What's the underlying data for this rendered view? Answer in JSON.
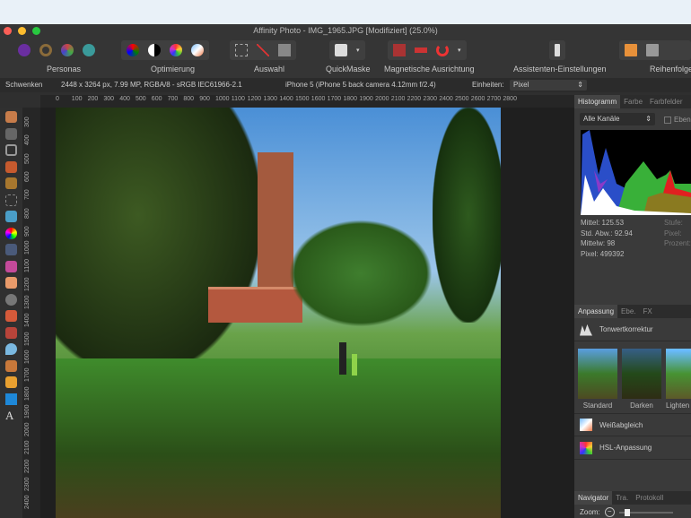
{
  "window": {
    "title": "Affinity Photo - IMG_1965.JPG [Modifiziert] (25.0%)"
  },
  "toolbar": {
    "groups": [
      "Personas",
      "Optimierung",
      "Auswahl",
      "QuickMaske",
      "Magnetische Ausrichtung",
      "Assistenten-Einstellungen",
      "Reihenfolge"
    ]
  },
  "context": {
    "tool": "Schwenken",
    "image_info": "2448 x 3264 px, 7.99 MP, RGBA/8 - sRGB IEC61966-2.1",
    "camera": "iPhone 5 (iPhone 5 back camera 4.12mm f/2.4)",
    "units_label": "Einheiten:",
    "units_value": "Pixel"
  },
  "ruler": {
    "unit": "px",
    "h_ticks": [
      "0",
      "100",
      "200",
      "300",
      "400",
      "500",
      "600",
      "700",
      "800",
      "900",
      "1000",
      "1100",
      "1200",
      "1300",
      "1400",
      "1500",
      "1600",
      "1700",
      "1800",
      "1900",
      "2000",
      "2100",
      "2200",
      "2300",
      "2400",
      "2500",
      "2600",
      "2700",
      "2800"
    ],
    "v_ticks": [
      "300",
      "400",
      "500",
      "600",
      "700",
      "800",
      "900",
      "1000",
      "1100",
      "1200",
      "1300",
      "1400",
      "1500",
      "1600",
      "1700",
      "1800",
      "1900",
      "2000",
      "2100",
      "2200",
      "2300",
      "2400"
    ]
  },
  "histogram": {
    "tabs": [
      "Histogramm",
      "Farbe",
      "Farbfelder"
    ],
    "channel": "Alle Kanäle",
    "checkbox": "Ebene",
    "stats": [
      "Mittel: 125.53",
      "Std. Abw.: 92.94",
      "Mittelw: 98",
      "Pixel: 499392"
    ],
    "stats_right": [
      "Stufe:",
      "Pixel:",
      "Prozent:"
    ]
  },
  "adjust": {
    "tabs": [
      "Anpassung",
      "Ebe.",
      "FX"
    ],
    "levels": "Tonwertkorrektur",
    "presets": [
      "Standard",
      "Darken",
      "Lighten"
    ],
    "white_balance": "Weißabgleich",
    "hsl": "HSL-Anpassung"
  },
  "navigator": {
    "tabs": [
      "Navigator",
      "Tra.",
      "Protokoll"
    ],
    "zoom_label": "Zoom:"
  }
}
